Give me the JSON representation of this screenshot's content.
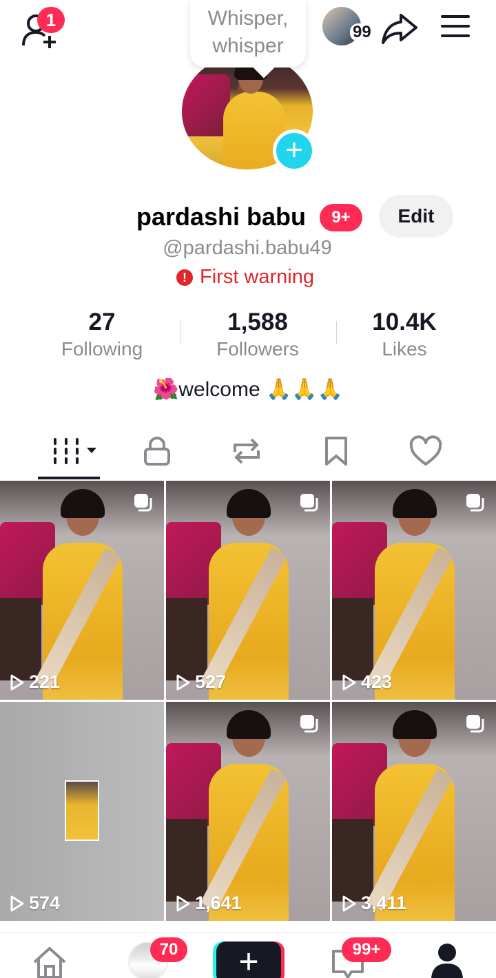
{
  "topbar": {
    "friend_badge": "1",
    "tooltip_line1": "Whisper,",
    "tooltip_line2": "whisper",
    "story_count": "99"
  },
  "profile": {
    "name": "pardashi babu",
    "name_badge": "9+",
    "edit_label": "Edit",
    "handle": "@pardashi.babu49",
    "warning": "First warning",
    "bio": "🌺welcome 🙏🙏🙏"
  },
  "stats": [
    {
      "value": "27",
      "label": "Following"
    },
    {
      "value": "1,588",
      "label": "Followers"
    },
    {
      "value": "10.4K",
      "label": "Likes"
    }
  ],
  "tabs": [
    {
      "icon": "grid-icon"
    },
    {
      "icon": "lock-icon"
    },
    {
      "icon": "repost-icon"
    },
    {
      "icon": "bookmark-icon"
    },
    {
      "icon": "heart-icon"
    }
  ],
  "videos": [
    {
      "views": "221"
    },
    {
      "views": "527"
    },
    {
      "views": "423"
    },
    {
      "views": "574"
    },
    {
      "views": "1,641"
    },
    {
      "views": "3,411"
    }
  ],
  "bottomnav": {
    "friends_badge": "70",
    "inbox_badge": "99+",
    "create_label": "+"
  },
  "colors": {
    "accent_red": "#fe2c55",
    "accent_cyan": "#20d5ec",
    "warning_red": "#e2252b",
    "muted_text": "#8a8b91"
  }
}
